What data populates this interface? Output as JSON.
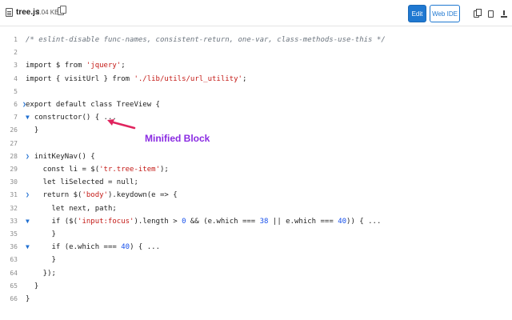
{
  "header": {
    "file_name": "tree.js",
    "file_size": "2.04 KB",
    "edit_label": "Edit",
    "webide_label": "Web IDE"
  },
  "colors": {
    "primary_blue": "#1f78d1",
    "annotation_purple": "#8a2be2",
    "annotation_arrow": "#e0245e"
  },
  "annotation": {
    "label": "Minified Block"
  },
  "code": {
    "lines": [
      {
        "n": "1",
        "arrow": "",
        "text": "/* eslint-disable func-names, consistent-return, one-var, class-methods-use-this */",
        "cls": "cm"
      },
      {
        "n": "2",
        "arrow": "",
        "text": ""
      },
      {
        "n": "3",
        "arrow": "",
        "text": "import $ from 'jquery';"
      },
      {
        "n": "4",
        "arrow": "",
        "text": "import { visitUrl } from './lib/utils/url_utility';"
      },
      {
        "n": "5",
        "arrow": "",
        "text": ""
      },
      {
        "n": "6",
        "arrow": "right",
        "text": "export default class TreeView {"
      },
      {
        "n": "7",
        "arrow": "down",
        "text": "  constructor() { ..."
      },
      {
        "n": "26",
        "arrow": "",
        "text": "  }"
      },
      {
        "n": "27",
        "arrow": "",
        "text": ""
      },
      {
        "n": "28",
        "arrow": "right",
        "text": "  initKeyNav() {"
      },
      {
        "n": "29",
        "arrow": "",
        "text": "    const li = $('tr.tree-item');"
      },
      {
        "n": "30",
        "arrow": "",
        "text": "    let liSelected = null;"
      },
      {
        "n": "31",
        "arrow": "right",
        "text": "    return $('body').keydown(e => {"
      },
      {
        "n": "32",
        "arrow": "",
        "text": "      let next, path;"
      },
      {
        "n": "33",
        "arrow": "down",
        "text": "      if ($('input:focus').length > 0 && (e.which === 38 || e.which === 40)) { ..."
      },
      {
        "n": "35",
        "arrow": "",
        "text": "      }"
      },
      {
        "n": "36",
        "arrow": "down",
        "text": "      if (e.which === 40) { ..."
      },
      {
        "n": "63",
        "arrow": "",
        "text": "      }"
      },
      {
        "n": "64",
        "arrow": "",
        "text": "    });"
      },
      {
        "n": "65",
        "arrow": "",
        "text": "  }"
      },
      {
        "n": "66",
        "arrow": "",
        "text": "}"
      }
    ]
  }
}
